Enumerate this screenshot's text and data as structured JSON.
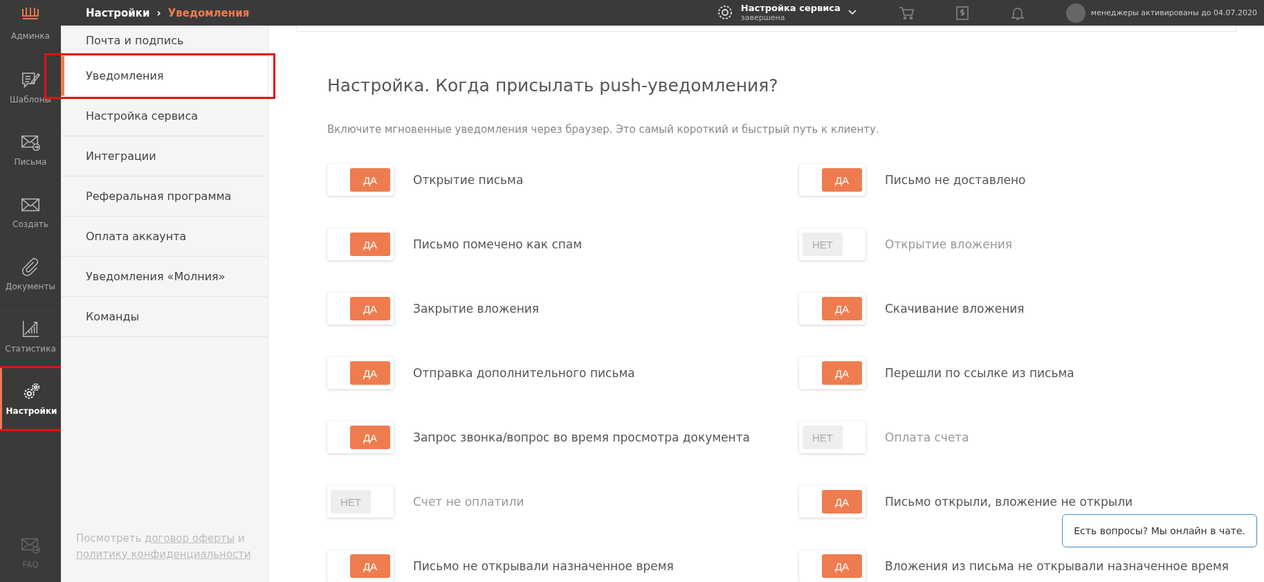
{
  "topbar": {
    "breadcrumb": [
      "Настройки",
      "›",
      "Уведомления"
    ],
    "service": {
      "title": "Настройка сервиса",
      "status": "завершена"
    },
    "account_note": "менеджеры активированы до 04.07.2020"
  },
  "rail": {
    "items": [
      {
        "label": "Админка",
        "selected": false
      },
      {
        "label": "Шаблоны",
        "selected": false
      },
      {
        "label": "Письма",
        "selected": false
      },
      {
        "label": "Создать",
        "selected": false
      },
      {
        "label": "Документы",
        "selected": false
      },
      {
        "label": "Статистика",
        "selected": false
      },
      {
        "label": "Настройки",
        "selected": true
      }
    ],
    "footer": {
      "label": "FAQ"
    }
  },
  "submenu": {
    "items": [
      {
        "label": "Почта и подпись",
        "selected": false
      },
      {
        "label": "Уведомления",
        "selected": true
      },
      {
        "label": "Настройка сервиса",
        "selected": false
      },
      {
        "label": "Интеграции",
        "selected": false
      },
      {
        "label": "Реферальная программа",
        "selected": false
      },
      {
        "label": "Оплата аккаунта",
        "selected": false
      },
      {
        "label": "Уведомления «Молния»",
        "selected": false
      },
      {
        "label": "Команды",
        "selected": false
      }
    ],
    "footer": {
      "before": "Посмотреть",
      "link1": "договор оферты",
      "middle": "и",
      "link2": "политику конфиденциальности"
    }
  },
  "content": {
    "title": "Настройка. Когда присылать push-уведомления?",
    "subtitle": "Включите мгновенные уведомления через браузер. Это самый короткий и быстрый путь к клиенту.",
    "toggles": [
      {
        "label": "Открытие письма",
        "on": true,
        "toggle_text": "ДА"
      },
      {
        "label": "Письмо не доставлено",
        "on": true,
        "toggle_text": "ДА"
      },
      {
        "label": "Письмо помечено как спам",
        "on": true,
        "toggle_text": "ДА"
      },
      {
        "label": "Открытие вложения",
        "on": false,
        "toggle_text": "НЕТ"
      },
      {
        "label": "Закрытие вложения",
        "on": true,
        "toggle_text": "ДА"
      },
      {
        "label": "Скачивание вложения",
        "on": true,
        "toggle_text": "ДА"
      },
      {
        "label": "Отправка дополнительного письма",
        "on": true,
        "toggle_text": "ДА"
      },
      {
        "label": "Перешли по ссылке из письма",
        "on": true,
        "toggle_text": "ДА"
      },
      {
        "label": "Запрос звонка/вопрос во время просмотра документа",
        "on": true,
        "toggle_text": "ДА"
      },
      {
        "label": "Оплата счета",
        "on": false,
        "toggle_text": "НЕТ"
      },
      {
        "label": "Счет не оплатили",
        "on": false,
        "toggle_text": "НЕТ"
      },
      {
        "label": "Письмо открыли, вложение не открыли",
        "on": true,
        "toggle_text": "ДА"
      },
      {
        "label": "Письмо не открывали назначенное время",
        "on": true,
        "toggle_text": "ДА"
      },
      {
        "label": "Вложения из письма не открывали назначенное время",
        "on": true,
        "toggle_text": "ДА"
      }
    ]
  },
  "chat": {
    "text": "Есть вопросы? Мы онлайн в чате."
  }
}
